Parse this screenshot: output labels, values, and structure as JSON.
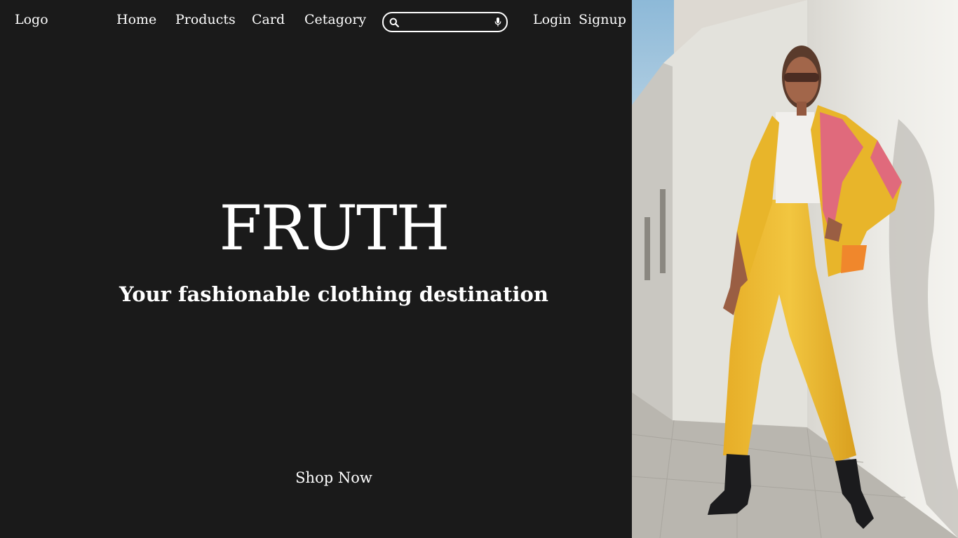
{
  "nav": {
    "logo": "Logo",
    "items": [
      {
        "label": "Home"
      },
      {
        "label": "Products"
      },
      {
        "label": "Card"
      },
      {
        "label": "Cetagory"
      }
    ],
    "login": "Login",
    "signup": "Signup"
  },
  "search": {
    "placeholder": "",
    "value": "",
    "icon": "search-icon",
    "mic_icon": "microphone-icon"
  },
  "hero": {
    "brand": "FRUTH",
    "tagline": "Your fashionable clothing destination",
    "cta": "Shop Now"
  },
  "photo": {
    "alt": "Model in yellow trousers and a pink and yellow jacket leaning against a white wall"
  },
  "colors": {
    "background": "#1a1a1a",
    "text": "#ffffff",
    "jacket_pink": "#e06a7c",
    "jacket_yellow": "#e8b52a"
  }
}
